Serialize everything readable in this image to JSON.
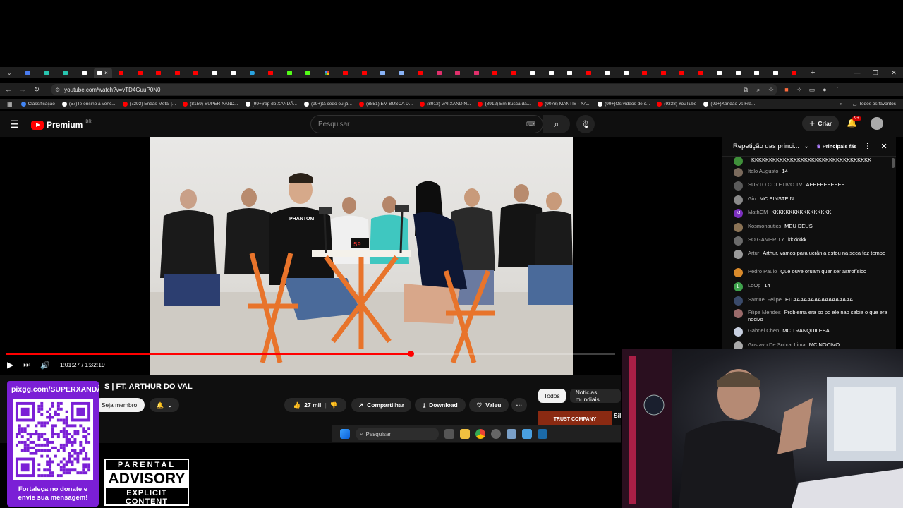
{
  "browser": {
    "url": "youtube.com/watch?v=vTD4GuuP0N0",
    "active_tab_close": "×",
    "new_tab": "+",
    "bookmarks": [
      {
        "label": "Classificação",
        "color": "#4285f4"
      },
      {
        "label": "(57)Te ensino a venc...",
        "color": "#ffffff"
      },
      {
        "label": "(7292) Enéas Metal |...",
        "color": "#ff0000"
      },
      {
        "label": "(8159) SUPER XAND...",
        "color": "#ff0000"
      },
      {
        "label": "(99+)rap do XANDÃ...",
        "color": "#ffffff"
      },
      {
        "label": "(99+)tá cedo ou já...",
        "color": "#ffffff"
      },
      {
        "label": "(8851) EM BUSCA D...",
        "color": "#ff0000"
      },
      {
        "label": "(8912) VAI XANDIN...",
        "color": "#ff0000"
      },
      {
        "label": "(8912) Em Busca da...",
        "color": "#ff0000"
      },
      {
        "label": "(9078) MANTIS · XA...",
        "color": "#ff0000"
      },
      {
        "label": "(99+)Os vídeos de c...",
        "color": "#ffffff"
      },
      {
        "label": "(9338) YouTube",
        "color": "#ff0000"
      },
      {
        "label": "(99+)Xandão vs Fra...",
        "color": "#ffffff"
      }
    ],
    "bookmarks_more": "»",
    "all_favorites": "Todos os favoritos"
  },
  "youtube": {
    "logo_text": "Premium",
    "logo_region": "BR",
    "search_placeholder": "Pesquisar",
    "create_label": "Criar",
    "notif_badge": "9+"
  },
  "video": {
    "title_visible": "S | FT. ARTHUR DO VAL",
    "time_current": "1:01:27",
    "time_total": "1:32:19",
    "time_sep": "/",
    "progress": 0.664,
    "likes": "27 mil",
    "share_label": "Compartilhar",
    "download_label": "Download",
    "thanks_label": "Valeu",
    "more_label": "···",
    "member_label": "Seja membro",
    "scene_sign": "PHANTOM"
  },
  "chips": [
    {
      "label": "Todos",
      "active": true
    },
    {
      "label": "Notícias mundiais",
      "active": false
    }
  ],
  "recommendation": {
    "thumb_text": "TRUST COMPANY",
    "title_start": "Sil"
  },
  "taskbar": {
    "search_placeholder": "Pesquisar"
  },
  "chat": {
    "title": "Repetição das princi...",
    "filter_label": "Principais fãs",
    "messages": [
      {
        "author": "",
        "text": "KKKKKKKKKKKKKKKKKKKKKKKKKKKKKKKKKK",
        "avatar_color": "#3f8f3a",
        "initial": ""
      },
      {
        "author": "Italo Augusto",
        "text": "14",
        "avatar_color": "#7a6a5c",
        "initial": ""
      },
      {
        "author": "SURTO COLETIVO TV",
        "text": "AEEEEEEEEEE",
        "avatar_color": "#5a5a5a",
        "initial": ""
      },
      {
        "author": "Giu",
        "text": "MC EINSTEIN",
        "avatar_color": "#8a8a8a",
        "initial": ""
      },
      {
        "author": "MathCM",
        "text": "KKKKKKKKKKKKKKKKK",
        "avatar_color": "#7b2fbe",
        "initial": "M"
      },
      {
        "author": "Kosmonautics",
        "text": "MEU DEUS",
        "avatar_color": "#8b7355",
        "initial": ""
      },
      {
        "author": "SO GAMER TY",
        "text": "kkkkkkk",
        "avatar_color": "#6b6b6b",
        "initial": ""
      },
      {
        "author": "Artur",
        "text": "Arthur, vamos para ucrânia estou na seca faz tempo",
        "avatar_color": "#9a9a9a",
        "initial": ""
      },
      {
        "author": "Pedro Paulo",
        "text": "Que ouve oruam quer ser astrofísico",
        "avatar_color": "#d98a2b",
        "initial": ""
      },
      {
        "author": "LoOp",
        "text": "14",
        "avatar_color": "#3fa34d",
        "initial": "L"
      },
      {
        "author": "Samuel Felipe",
        "text": "EITAAAAAAAAAAAAAAAAA",
        "avatar_color": "#3a4a6a",
        "initial": ""
      },
      {
        "author": "Filipe Mendes",
        "text": "Problema era so pq ele nao sabia o que era nocivo",
        "avatar_color": "#9a6a6a",
        "initial": ""
      },
      {
        "author": "Gabriel Chen",
        "text": "MC TRANQUILEBA",
        "avatar_color": "#c8d0e0",
        "initial": ""
      },
      {
        "author": "Gustavo De Sobral Lima",
        "text": "MC NOCIVO",
        "avatar_color": "#aaaaaa",
        "initial": ""
      }
    ]
  },
  "overlay": {
    "donate_url": "pixgg.com/SUPERXANDÃO",
    "donate_msg_line1": "Fortaleça no donate e",
    "donate_msg_line2": "envie sua mensagem!",
    "advisory_top": "PARENTAL",
    "advisory_mid": "ADVISORY",
    "advisory_bottom": "EXPLICIT CONTENT"
  },
  "colors": {
    "accent": "#ff0000",
    "donate_bg": "#7b1fd6",
    "chair": "#e8742b"
  }
}
